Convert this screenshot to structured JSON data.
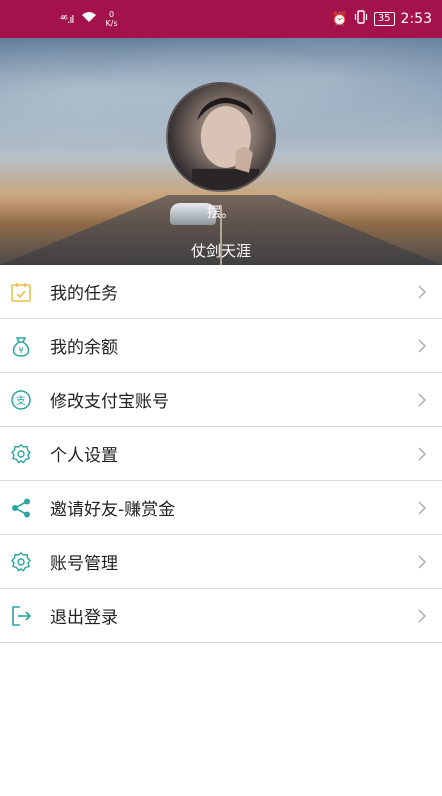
{
  "status_bar": {
    "signal": "⁴⁶.ıl",
    "speed_value": "0",
    "speed_unit": "K/s",
    "battery": "35",
    "time": "2:53"
  },
  "profile": {
    "nickname": "摆。",
    "username": "仗剑天涯"
  },
  "menu": [
    {
      "label": "我的任务",
      "icon": "task-icon",
      "color": "#e6c24a"
    },
    {
      "label": "我的余额",
      "icon": "money-bag-icon",
      "color": "#2aa6a0"
    },
    {
      "label": "修改支付宝账号",
      "icon": "alipay-icon",
      "color": "#2aa6a0"
    },
    {
      "label": "个人设置",
      "icon": "gear-icon",
      "color": "#2aa6a0"
    },
    {
      "label": "邀请好友-赚赏金",
      "icon": "share-icon",
      "color": "#2aa6a0"
    },
    {
      "label": "账号管理",
      "icon": "gear-icon",
      "color": "#2aa6a0"
    },
    {
      "label": "退出登录",
      "icon": "logout-icon",
      "color": "#2aa6a0"
    }
  ]
}
